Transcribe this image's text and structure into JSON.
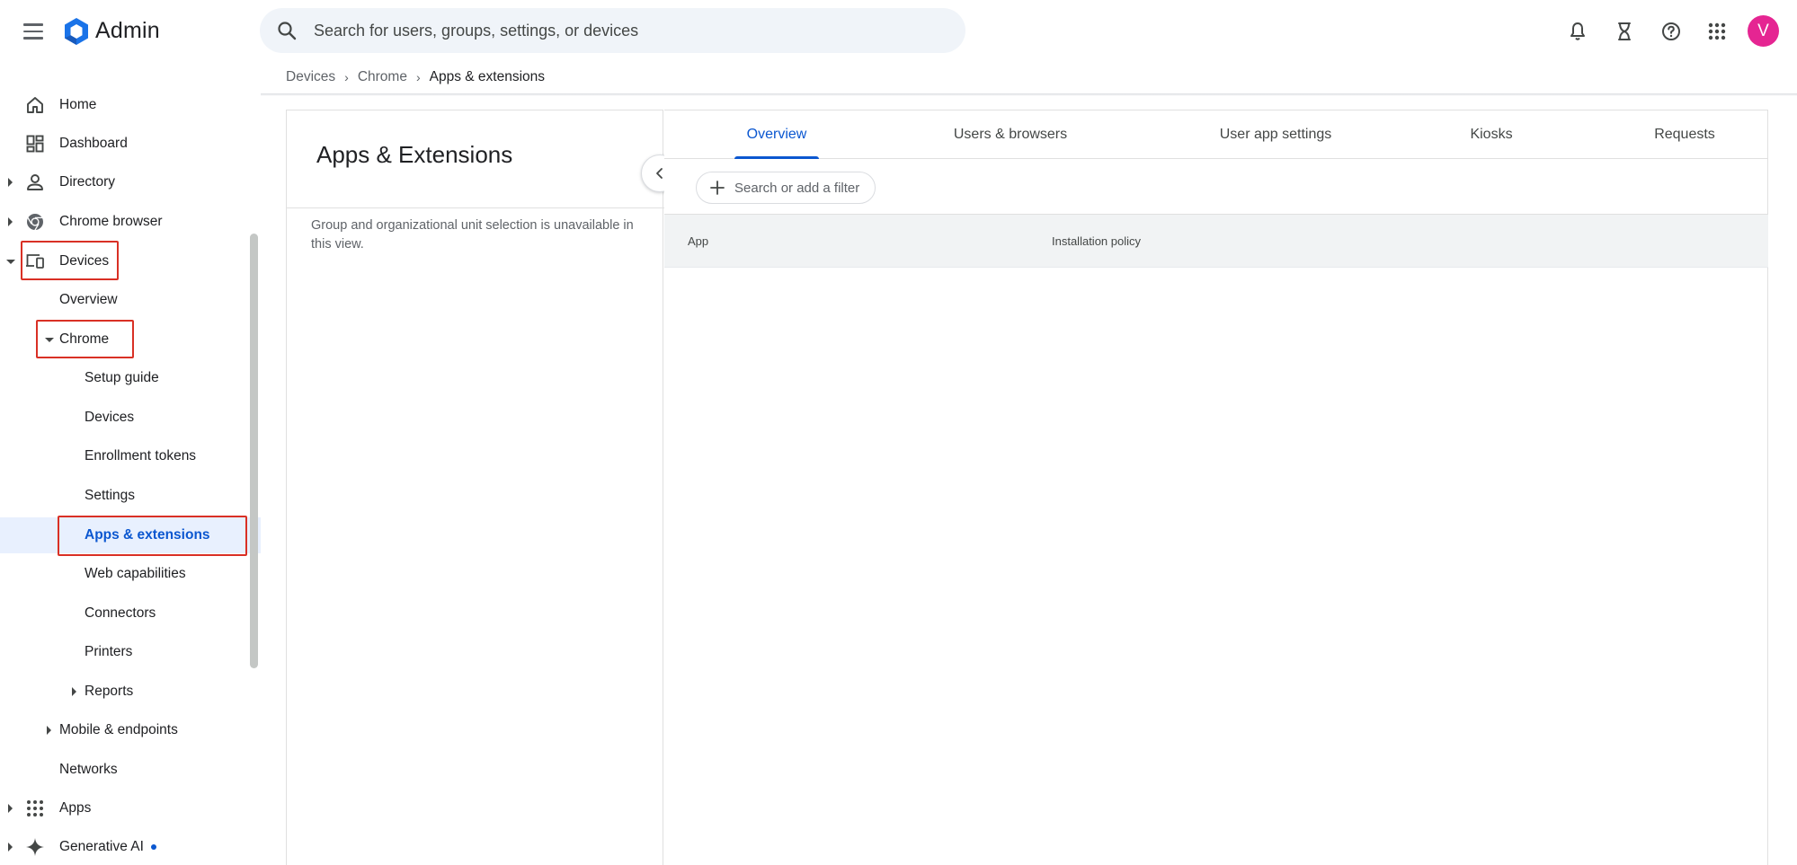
{
  "app": {
    "name": "Admin",
    "avatar_initial": "V",
    "brand_color": "#1a73e8",
    "avatar_color": "#e52592"
  },
  "search": {
    "placeholder": "Search for users, groups, settings, or devices"
  },
  "top_icons": [
    "notifications-bell-icon",
    "hourglass-tasks-icon",
    "help-icon",
    "apps-grid-icon"
  ],
  "sidebar": {
    "items": [
      {
        "label": "Home",
        "icon": "home-icon"
      },
      {
        "label": "Dashboard",
        "icon": "dashboard-icon"
      },
      {
        "label": "Directory",
        "icon": "person-icon"
      },
      {
        "label": "Chrome browser",
        "icon": "chrome-icon"
      },
      {
        "label": "Devices",
        "icon": "devices-icon"
      },
      {
        "label": "Overview"
      },
      {
        "label": "Chrome"
      },
      {
        "label": "Setup guide"
      },
      {
        "label": "Devices"
      },
      {
        "label": "Enrollment tokens"
      },
      {
        "label": "Settings"
      },
      {
        "label": "Apps & extensions"
      },
      {
        "label": "Web capabilities"
      },
      {
        "label": "Connectors"
      },
      {
        "label": "Printers"
      },
      {
        "label": "Reports"
      },
      {
        "label": "Mobile & endpoints"
      },
      {
        "label": "Networks"
      },
      {
        "label": "Apps",
        "icon": "apps-grid-icon"
      },
      {
        "label": "Generative AI",
        "icon": "sparkle-icon"
      }
    ]
  },
  "breadcrumb": {
    "items": [
      "Devices",
      "Chrome",
      "Apps & extensions"
    ]
  },
  "left_panel": {
    "title": "Apps & Extensions",
    "note": "Group and organizational unit selection is unavailable in this view."
  },
  "tabs": [
    {
      "label": "Overview",
      "active": true
    },
    {
      "label": "Users & browsers"
    },
    {
      "label": "User app settings"
    },
    {
      "label": "Kiosks"
    },
    {
      "label": "Requests"
    }
  ],
  "filter": {
    "label": "Search or add a filter"
  },
  "table": {
    "columns": [
      "App",
      "Installation policy"
    ]
  }
}
